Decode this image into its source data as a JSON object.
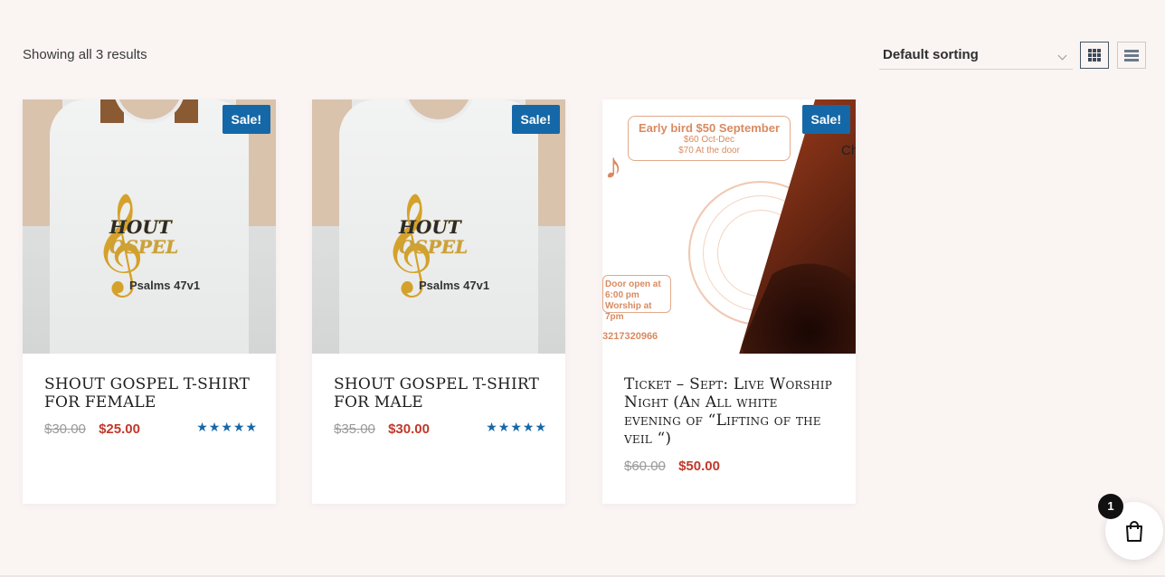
{
  "shop": {
    "result_count": "Showing all 3 results",
    "sorting": {
      "selected": "Default sorting"
    },
    "view_modes": [
      "grid-icon",
      "list-icon"
    ],
    "active_view": "grid"
  },
  "products": [
    {
      "title": "SHOUT GOSPEL T-SHIRT FOR FEMALE",
      "badge": "Sale!",
      "old_price": "$30.00",
      "new_price": "$25.00",
      "rating": 5,
      "stars": "★★★★★",
      "image": {
        "logo_line1": "HOUT",
        "logo_line2": "OSPEL",
        "caption": "Psalms 47v1"
      }
    },
    {
      "title": "SHOUT GOSPEL T-SHIRT FOR MALE",
      "badge": "Sale!",
      "old_price": "$35.00",
      "new_price": "$30.00",
      "rating": 5,
      "stars": "★★★★★",
      "image": {
        "logo_line1": "HOUT",
        "logo_line2": "OSPEL",
        "caption": "Psalms 47v1"
      }
    },
    {
      "title": "Ticket – Sept: Live Worship Night (An All white evening of “Lifting of the veil “)",
      "badge": "Sale!",
      "old_price": "$60.00",
      "new_price": "$50.00",
      "image": {
        "line1": "Early bird $50 September",
        "line2": "$60 Oct-Dec",
        "line3": "$70 At the door",
        "door1": "Door open at",
        "door2": "6:00 pm",
        "door3": "Worship at 7pm",
        "phone": "3217320966",
        "corner": "Ch"
      }
    }
  ],
  "cart": {
    "count": "1"
  },
  "colors": {
    "accent": "#1568a8",
    "sale_price": "#c0392b",
    "background": "#faf4f3"
  }
}
